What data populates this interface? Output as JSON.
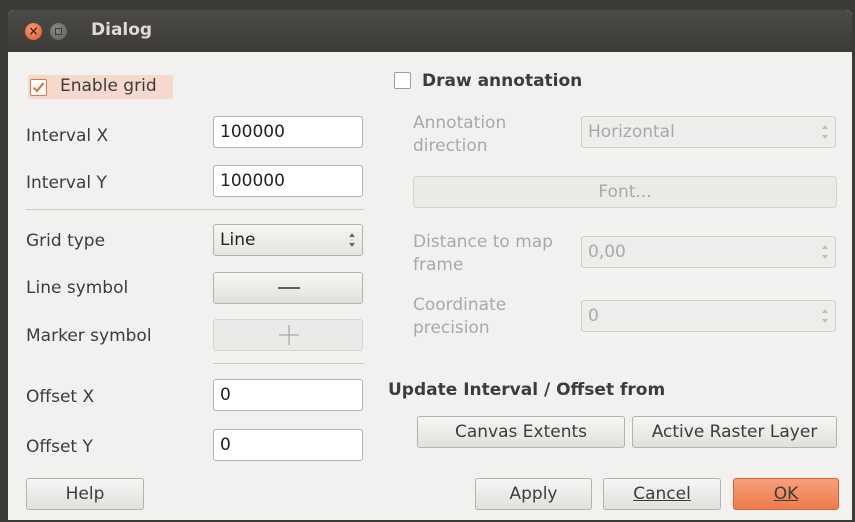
{
  "window": {
    "title": "Dialog",
    "close_glyph": "×"
  },
  "grid": {
    "enable_label": "Enable grid",
    "interval_x_label": "Interval X",
    "interval_x_value": "100000",
    "interval_y_label": "Interval Y",
    "interval_y_value": "100000",
    "grid_type_label": "Grid type",
    "grid_type_value": "Line",
    "line_symbol_label": "Line symbol",
    "marker_symbol_label": "Marker symbol",
    "offset_x_label": "Offset X",
    "offset_x_value": "0",
    "offset_y_label": "Offset Y",
    "offset_y_value": "0"
  },
  "annotation": {
    "draw_label": "Draw annotation",
    "direction_label_1": "Annotation",
    "direction_label_2": "direction",
    "direction_value": "Horizontal",
    "font_button": "Font...",
    "distance_label_1": "Distance to map",
    "distance_label_2": "frame",
    "distance_value": "0,00",
    "precision_label_1": "Coordinate",
    "precision_label_2": "precision",
    "precision_value": "0"
  },
  "update": {
    "heading": "Update Interval / Offset from",
    "canvas_extents_button": "Canvas Extents",
    "active_raster_button": "Active Raster Layer"
  },
  "footer": {
    "help_button": "Help",
    "apply_button": "Apply",
    "cancel_button": "Cancel",
    "ok_button": "OK"
  },
  "colors": {
    "accent": "#ef7a4a",
    "titlebar": "#3c3b37"
  }
}
